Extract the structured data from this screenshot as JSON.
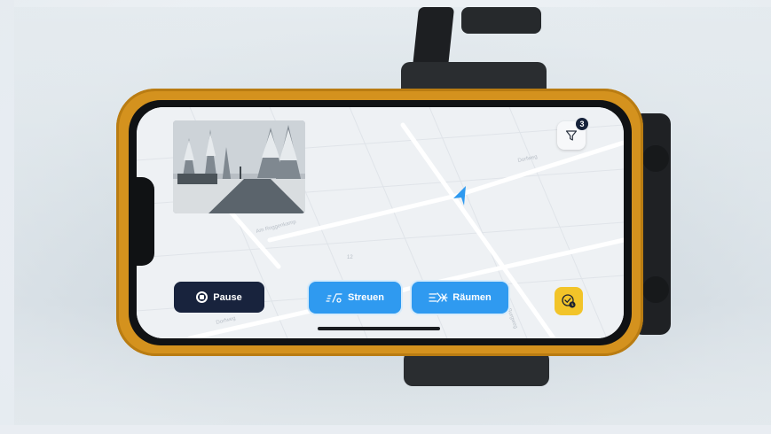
{
  "app": {
    "camera_preview": {
      "icon": "camera-feed"
    },
    "filter": {
      "badge_count": "3",
      "icon": "filter-icon"
    },
    "controls": {
      "pause_label": "Pause",
      "streuen_label": "Streuen",
      "raeumen_label": "Räumen"
    },
    "status_button": {
      "icon": "check-clock-icon"
    },
    "map": {
      "street_labels": [
        "Dorfweg",
        "Am Roggenkamp",
        "Burgweg",
        "12"
      ],
      "location_marker": "navigation-arrow-icon"
    }
  },
  "colors": {
    "case_orange": "#d4921e",
    "primary_blue": "#2f9af0",
    "dark_navy": "#18233d",
    "accent_yellow": "#f2c429"
  }
}
